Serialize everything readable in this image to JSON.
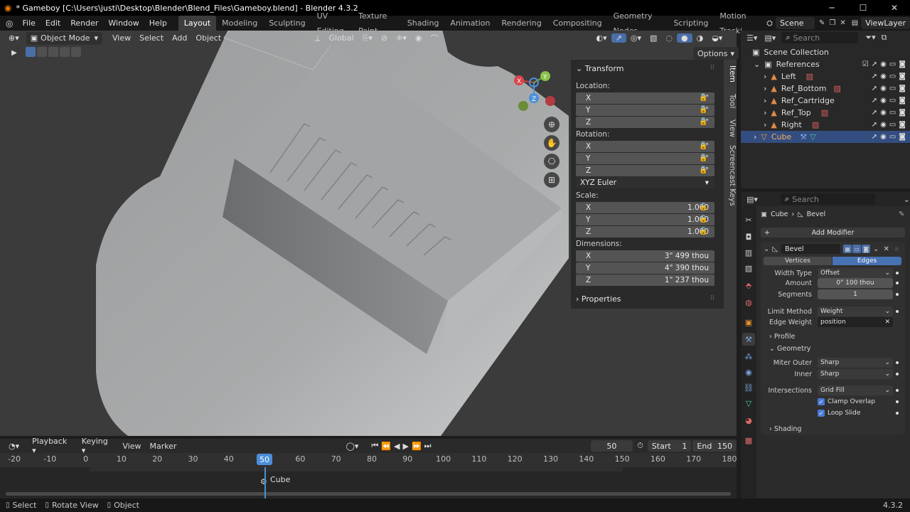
{
  "window": {
    "title": "* Gameboy [C:\\Users\\justi\\Desktop\\Blender\\Blend_Files\\Gameboy.blend] - Blender 4.3.2",
    "minimize": "─",
    "maximize": "☐",
    "close": "✕"
  },
  "menu": {
    "items": [
      "File",
      "Edit",
      "Render",
      "Window",
      "Help"
    ]
  },
  "workspaces": {
    "tabs": [
      "Layout",
      "Modeling",
      "Sculpting",
      "UV Editing",
      "Texture Paint",
      "Shading",
      "Animation",
      "Rendering",
      "Compositing",
      "Geometry Nodes",
      "Scripting",
      "Motion Tracki"
    ],
    "active": "Layout"
  },
  "scene": {
    "name": "Scene",
    "view_layer": "ViewLayer"
  },
  "viewport_header": {
    "mode": "Object Mode",
    "menus": [
      "View",
      "Select",
      "Add",
      "Object"
    ],
    "orientation": "Global",
    "options": "Options"
  },
  "npanel": {
    "transform_title": "Transform",
    "location_label": "Location:",
    "location": [
      {
        "axis": "X",
        "value": "0\""
      },
      {
        "axis": "Y",
        "value": "0\""
      },
      {
        "axis": "Z",
        "value": "0\""
      }
    ],
    "rotation_label": "Rotation:",
    "rotation": [
      {
        "axis": "X",
        "value": "0°"
      },
      {
        "axis": "Y",
        "value": "0°"
      },
      {
        "axis": "Z",
        "value": "0°"
      }
    ],
    "rotation_mode": "XYZ Euler",
    "scale_label": "Scale:",
    "scale": [
      {
        "axis": "X",
        "value": "1.000"
      },
      {
        "axis": "Y",
        "value": "1.000"
      },
      {
        "axis": "Z",
        "value": "1.000"
      }
    ],
    "dimensions_label": "Dimensions:",
    "dimensions": [
      {
        "axis": "X",
        "value": "3\" 499 thou"
      },
      {
        "axis": "Y",
        "value": "4\" 390 thou"
      },
      {
        "axis": "Z",
        "value": "1\" 237 thou"
      }
    ],
    "properties_title": "Properties"
  },
  "side_tabs": [
    "Item",
    "Tool",
    "View",
    "Screencast Keys"
  ],
  "gizmo": {
    "x": "X",
    "y": "Y",
    "z": "Z"
  },
  "timeline": {
    "menus": [
      "Playback",
      "Keying",
      "View",
      "Marker"
    ],
    "current_frame": "50",
    "start_label": "Start",
    "start": "1",
    "end_label": "End",
    "end": "150",
    "ticks": [
      "-20",
      "-10",
      "0",
      "10",
      "20",
      "30",
      "40",
      "50",
      "60",
      "70",
      "80",
      "90",
      "100",
      "110",
      "120",
      "130",
      "140",
      "150",
      "160",
      "170",
      "180"
    ],
    "object_label": "Cube"
  },
  "status": {
    "select": "Select",
    "rotate": "Rotate View",
    "object": "Object",
    "version": "4.3.2"
  },
  "outliner": {
    "search_placeholder": "Search",
    "rows": [
      {
        "name": "Scene Collection",
        "indent": 0
      },
      {
        "name": "References",
        "indent": 1
      },
      {
        "name": "Left",
        "indent": 2
      },
      {
        "name": "Ref_Bottom",
        "indent": 2
      },
      {
        "name": "Ref_Cartridge",
        "indent": 2
      },
      {
        "name": "Ref_Top",
        "indent": 2
      },
      {
        "name": "Right",
        "indent": 2
      },
      {
        "name": "Cube",
        "indent": 1
      }
    ]
  },
  "properties": {
    "search_placeholder": "Search",
    "breadcrumb_object": "Cube",
    "breadcrumb_modifier": "Bevel",
    "add_modifier": "Add Modifier",
    "modifier_name": "Bevel",
    "affect_tabs": [
      "Vertices",
      "Edges"
    ],
    "affect_active": "Edges",
    "width_type_label": "Width Type",
    "width_type": "Offset",
    "amount_label": "Amount",
    "amount": "0\" 100 thou",
    "segments_label": "Segments",
    "segments": "1",
    "limit_method_label": "Limit Method",
    "limit_method": "Weight",
    "edge_weight_label": "Edge Weight",
    "edge_weight": "position",
    "profile_label": "Profile",
    "geometry_label": "Geometry",
    "miter_outer_label": "Miter Outer",
    "miter_outer": "Sharp",
    "inner_label": "Inner",
    "inner": "Sharp",
    "intersections_label": "Intersections",
    "intersections": "Grid Fill",
    "clamp_overlap": "Clamp Overlap",
    "loop_slide": "Loop Slide",
    "shading_label": "Shading"
  }
}
